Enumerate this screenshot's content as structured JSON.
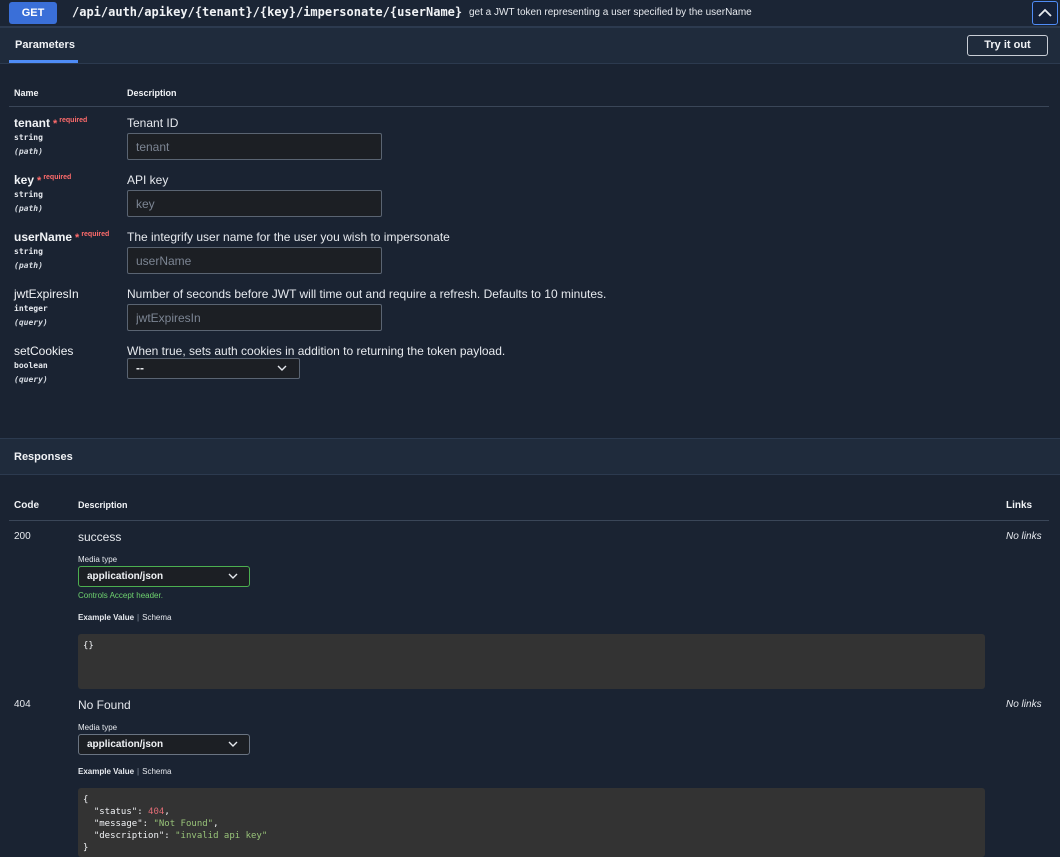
{
  "operation": {
    "method": "GET",
    "path": "/api/auth/apikey/{tenant}/{key}/impersonate/{userName}",
    "summary": "get a JWT token representing a user specified by the userName"
  },
  "parameters_section": {
    "tab_label": "Parameters",
    "try_button": "Try it out",
    "col_name": "Name",
    "col_description": "Description",
    "required_star": "*",
    "required_label": "required",
    "items": [
      {
        "name": "tenant",
        "type": "string",
        "in": "(path)",
        "required": true,
        "description": "Tenant ID",
        "placeholder": "tenant"
      },
      {
        "name": "key",
        "type": "string",
        "in": "(path)",
        "required": true,
        "description": "API key",
        "placeholder": "key"
      },
      {
        "name": "userName",
        "type": "string",
        "in": "(path)",
        "required": true,
        "description": "The integrify user name for the user you wish to impersonate",
        "placeholder": "userName"
      },
      {
        "name": "jwtExpiresIn",
        "type": "integer",
        "in": "(query)",
        "required": false,
        "description": "Number of seconds before JWT will time out and require a refresh. Defaults to 10 minutes.",
        "placeholder": "jwtExpiresIn"
      },
      {
        "name": "setCookies",
        "type": "boolean",
        "in": "(query)",
        "required": false,
        "description": "When true, sets auth cookies in addition to returning the token payload.",
        "selected": "--"
      }
    ]
  },
  "responses_section": {
    "title": "Responses",
    "col_code": "Code",
    "col_description": "Description",
    "col_links": "Links",
    "media_type_label": "Media type",
    "example_value_label": "Example Value",
    "schema_label": "Schema",
    "items": [
      {
        "code": "200",
        "description": "success",
        "links": "No links",
        "media_type": "application/json",
        "controls_note": "Controls Accept header.",
        "example": "{}"
      },
      {
        "code": "404",
        "description": "No Found",
        "links": "No links",
        "media_type": "application/json",
        "example_lines": {
          "open": "{",
          "status_key": "\"status\"",
          "status_val": "404",
          "message_key": "\"message\"",
          "message_val": "\"Not Found\"",
          "description_key": "\"description\"",
          "description_val": "\"invalid api key\"",
          "close": "}"
        }
      }
    ]
  },
  "colors": {
    "background": "#1a2332",
    "method_get": "#3a6fd8",
    "accent": "#4f8cf7",
    "required": "#ff6b6b",
    "success_border": "#4caf50"
  }
}
